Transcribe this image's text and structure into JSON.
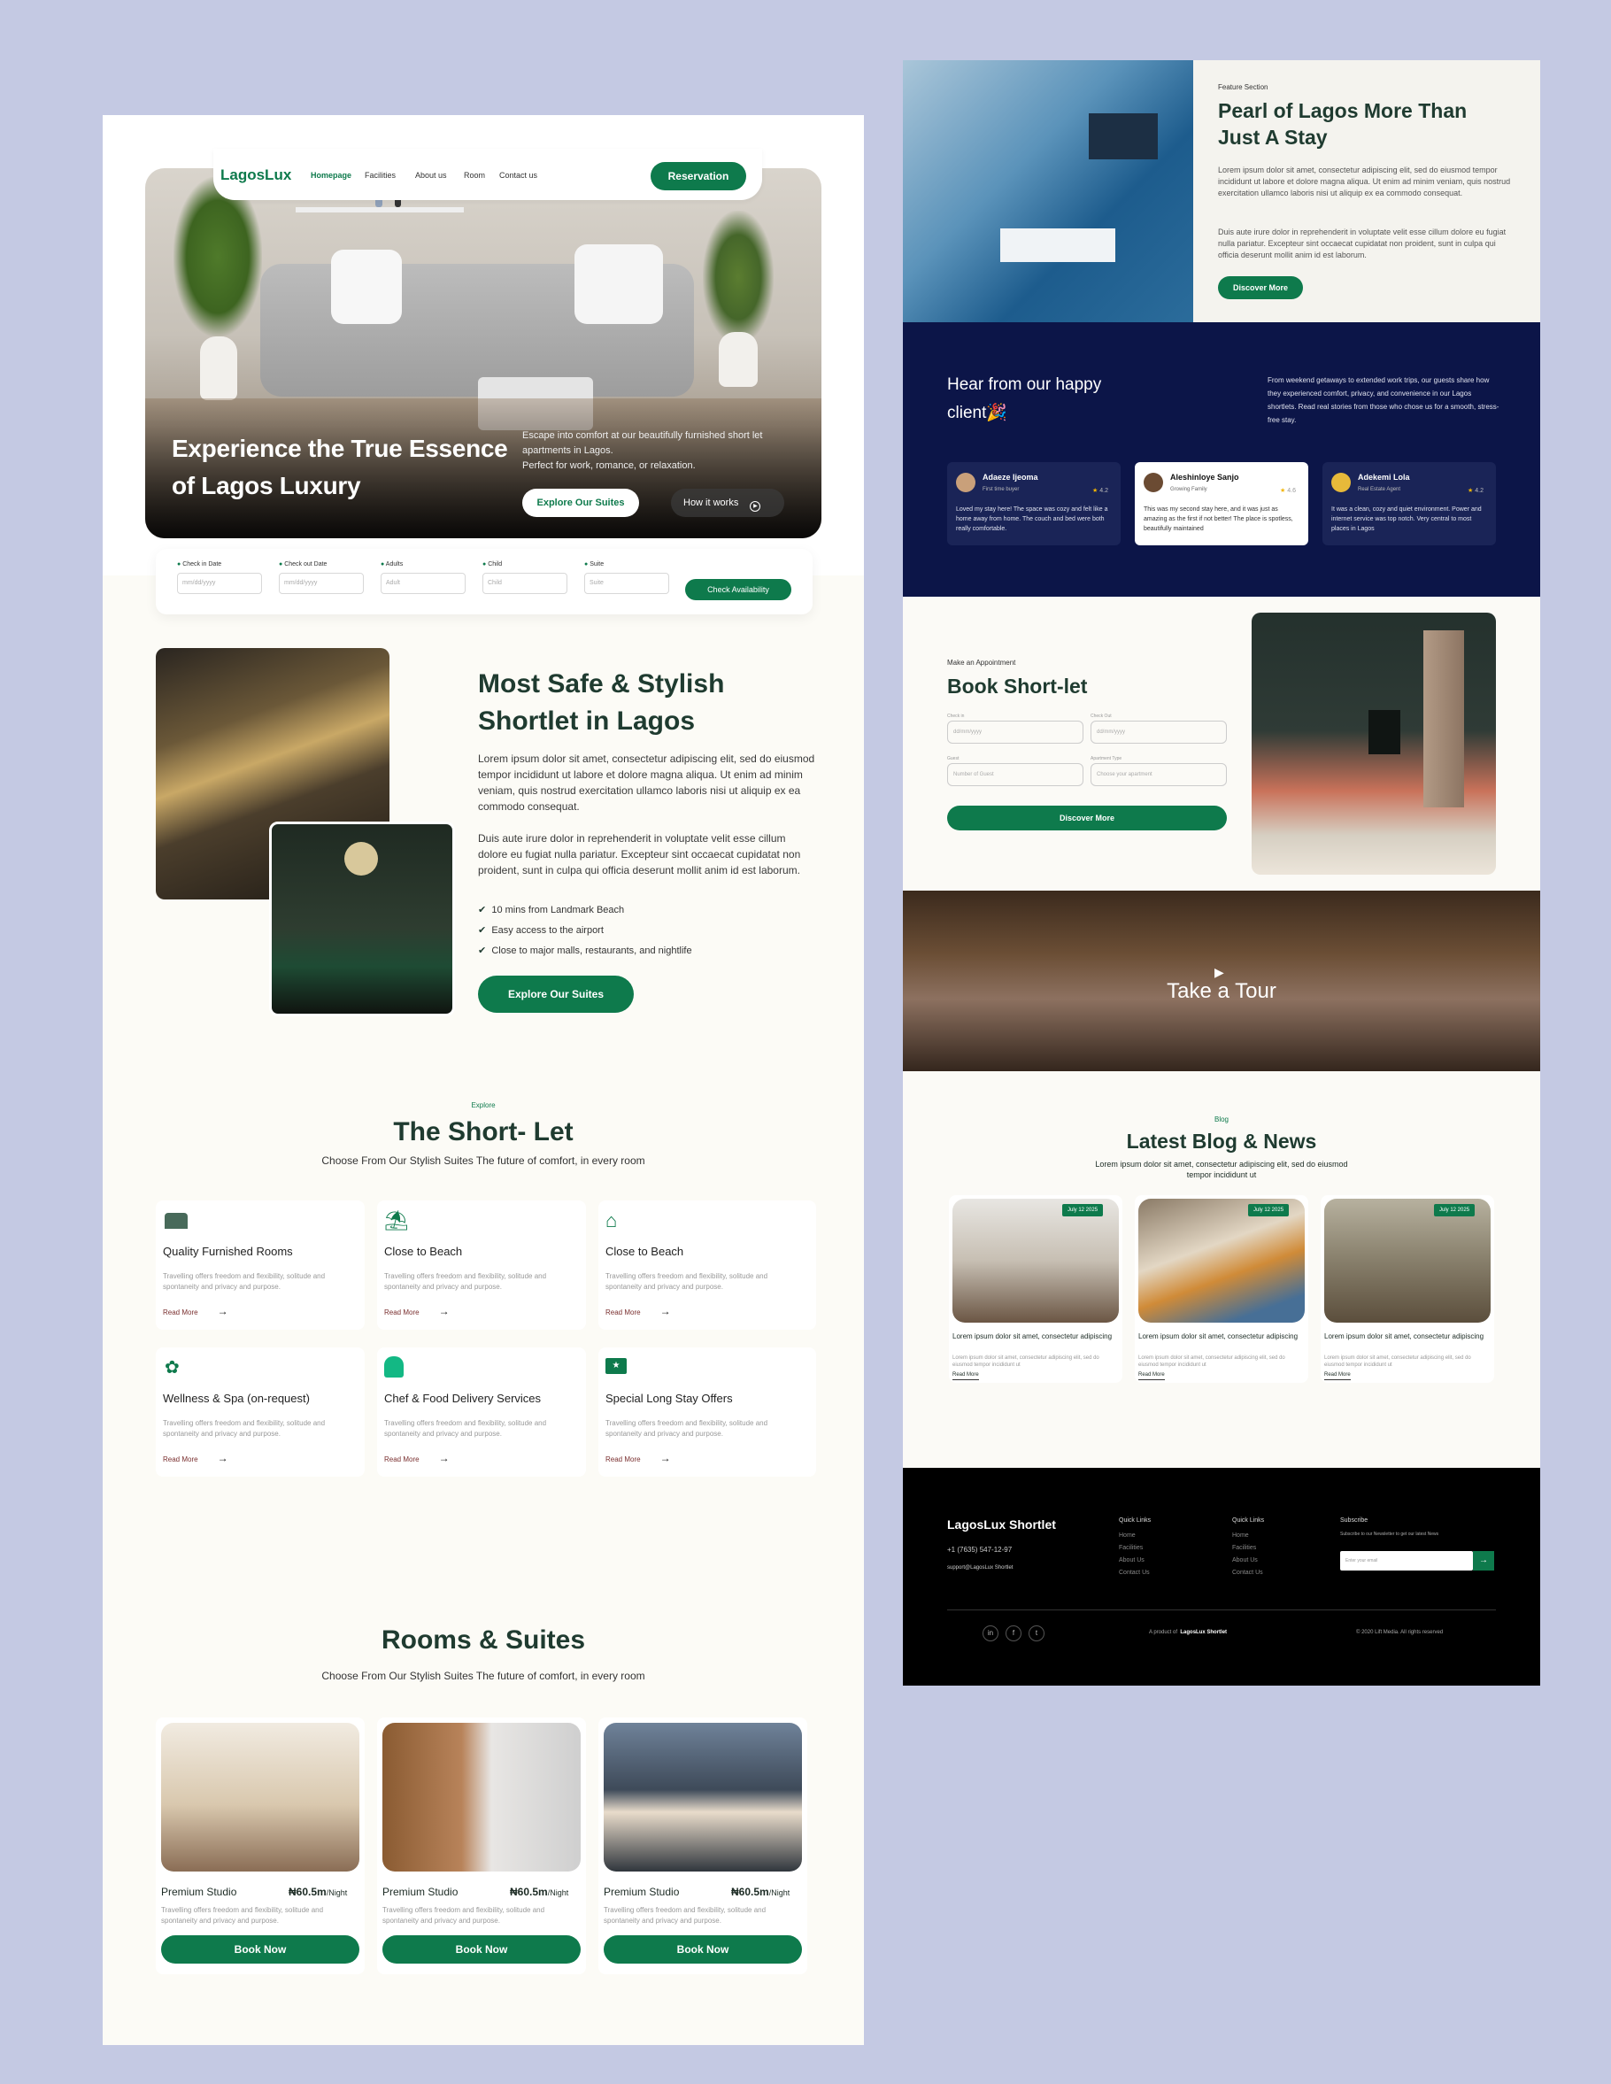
{
  "hero": {
    "logo": "LagosLux",
    "nav": [
      "Homepage",
      "Facilities",
      "About us",
      "Room",
      "Contact us"
    ],
    "reservation_label": "Reservation",
    "title_line1": "Experience the True Essence",
    "title_line2": "of Lagos Luxury",
    "sub_line1": "Escape into comfort at our beautifully furnished short let",
    "sub_line2": "apartments in Lagos.",
    "sub_line3": "Perfect for work, romance, or relaxation.",
    "primary_cta": "Explore Our Suites",
    "secondary_cta": "How it works"
  },
  "booking": {
    "fields": [
      {
        "label": "Check in Date",
        "placeholder": "mm/dd/yyyy"
      },
      {
        "label": "Check out Date",
        "placeholder": "mm/dd/yyyy"
      },
      {
        "label": "Adults",
        "placeholder": "Adult"
      },
      {
        "label": "Child",
        "placeholder": "Child"
      },
      {
        "label": "Suite",
        "placeholder": "Suite"
      }
    ],
    "submit": "Check Availability"
  },
  "about": {
    "title_line1": "Most Safe & Stylish",
    "title_line2": "Shortlet in Lagos",
    "para1": "Lorem ipsum dolor sit amet, consectetur adipiscing elit, sed do eiusmod tempor incididunt ut labore et dolore magna aliqua. Ut enim ad minim veniam, quis nostrud exercitation ullamco laboris nisi ut aliquip ex ea commodo consequat.",
    "para2": "Duis aute irure dolor in reprehenderit in voluptate velit esse cillum dolore eu fugiat nulla pariatur. Excepteur sint occaecat cupidatat non proident, sunt in culpa qui officia deserunt mollit anim id est laborum.",
    "bullets": [
      "10 mins from Landmark Beach",
      "Easy access to the airport",
      "Close to major malls, restaurants, and nightlife"
    ],
    "cta": "Explore Our Suites"
  },
  "shortlet": {
    "eyebrow": "Explore",
    "title": "The Short- Let",
    "subtitle": "Choose From Our Stylish Suites The future of comfort, in every room",
    "features": [
      {
        "title": "Quality Furnished Rooms",
        "icon": "bed-icon"
      },
      {
        "title": "Close to Beach",
        "icon": "palm-tree-icon"
      },
      {
        "title": "Close to Beach",
        "icon": "house-icon"
      },
      {
        "title": "Wellness & Spa (on-request)",
        "icon": "lotus-icon"
      },
      {
        "title": "Chef & Food Delivery Services",
        "icon": "chef-hat-icon"
      },
      {
        "title": "Special Long Stay Offers",
        "icon": "folder-star-icon"
      }
    ],
    "feature_desc": "Travelling offers freedom and flexibility, solitude and spontaneity and privacy and purpose.",
    "read_more": "Read More"
  },
  "rooms": {
    "title": "Rooms & Suites",
    "subtitle": "Choose From Our Stylish Suites The future of comfort, in every room",
    "items": [
      {
        "name": "Premium Studio",
        "price": "₦60.5m",
        "unit": "/Night"
      },
      {
        "name": "Premium Studio",
        "price": "₦60.5m",
        "unit": "/Night"
      },
      {
        "name": "Premium Studio",
        "price": "₦60.5m",
        "unit": "/Night"
      }
    ],
    "desc": "Travelling offers freedom and flexibility, solitude and spontaneity and privacy and purpose.",
    "book_label": "Book Now"
  },
  "feature": {
    "eyebrow": "Feature Section",
    "title_line1": "Pearl of Lagos  More Than",
    "title_line2": "Just A Stay",
    "para1": "Lorem ipsum dolor sit amet, consectetur adipiscing elit, sed do eiusmod tempor incididunt ut labore et dolore magna aliqua. Ut enim ad minim veniam, quis nostrud exercitation ullamco laboris nisi ut aliquip ex ea commodo consequat.",
    "para2": "Duis aute irure dolor in reprehenderit in voluptate velit esse cillum dolore eu fugiat nulla pariatur. Excepteur sint occaecat cupidatat non proident, sunt in culpa qui officia deserunt mollit anim id est laborum.",
    "cta": "Discover More"
  },
  "testimonials": {
    "title_line1": "Hear from our happy",
    "title_line2": "client🎉",
    "intro": "From weekend getaways to extended work trips, our guests share how they experienced comfort, privacy, and convenience in our Lagos shortlets. Read real stories from those who chose us for a smooth, stress-free stay.",
    "items": [
      {
        "name": "Adaeze Ijeoma",
        "role": "First time buyer",
        "rating": "4.2",
        "text": "Loved my stay here! The space was cozy and felt like a home away from home. The couch and bed were both really comfortable."
      },
      {
        "name": "Aleshinloye Sanjo",
        "role": "Growing Family",
        "rating": "4.6",
        "text": "This was my second stay here, and it was just as amazing as the first if not better! The place is spotless, beautifully maintained"
      },
      {
        "name": "Adekemi Lola",
        "role": "Real Estate Agent",
        "rating": "4.2",
        "text": "It was a clean, cozy and quiet environment. Power and internet service was top notch. Very central to most places in Lagos"
      }
    ]
  },
  "appointment": {
    "eyebrow": "Make an Appointment",
    "title": "Book Short-let",
    "fields": [
      {
        "label": "Check in",
        "placeholder": "dd/mm/yyyy"
      },
      {
        "label": "Check Out",
        "placeholder": "dd/mm/yyyy"
      },
      {
        "label": "Guest",
        "placeholder": "Number of Guest"
      },
      {
        "label": "Apartment Type",
        "placeholder": "Choose your apartment"
      }
    ],
    "cta": "Discover More"
  },
  "tour": {
    "label": "Take a Tour"
  },
  "blog": {
    "eyebrow": "Blog",
    "title": "Latest Blog & News",
    "subtitle_line1": "Lorem ipsum dolor sit amet, consectetur adipiscing elit, sed do eiusmod",
    "subtitle_line2": "tempor incididunt ut",
    "posts": [
      {
        "date": "July 12 2025",
        "title": "Lorem ipsum dolor sit amet, consectetur adipiscing",
        "excerpt": "Lorem ipsum dolor sit amet, consectetur adipiscing elit, sed do eiusmod tempor incididunt ut"
      },
      {
        "date": "July 12 2025",
        "title": "Lorem ipsum dolor sit amet, consectetur adipiscing",
        "excerpt": "Lorem ipsum dolor sit amet, consectetur adipiscing elit, sed do eiusmod tempor incididunt ut"
      },
      {
        "date": "July 12 2025",
        "title": "Lorem ipsum dolor sit amet, consectetur adipiscing",
        "excerpt": "Lorem ipsum dolor sit amet, consectetur adipiscing elit, sed do eiusmod tempor incididunt ut"
      }
    ],
    "read_more": "Read More"
  },
  "footer": {
    "brand": "LagosLux Shortlet",
    "phone": "+1 (7635) 547-12-97",
    "email": "support@LagosLux Shortlet",
    "col1_title": "Quick Links",
    "col1": [
      "Home",
      "Facilities",
      "About Us",
      "Contact  Us"
    ],
    "col2_title": "Quick Links",
    "col2": [
      "Home",
      "Facilities",
      "About Us",
      "Contact  Us"
    ],
    "subscribe_title": "Subscribe",
    "subscribe_text": "Subscribe to our Newsletter to get our latest News",
    "email_placeholder": "Enter your email",
    "social": [
      "in",
      "f",
      "t"
    ],
    "product_prefix": "A product of",
    "product_name": "LagosLux Shortlet",
    "copyright": "© 2020 Lift Media. All rights reserved"
  },
  "colors": {
    "brand_green": "#0e7a4c",
    "dark_navy": "#0c1548",
    "background": "#c4c9e3"
  }
}
